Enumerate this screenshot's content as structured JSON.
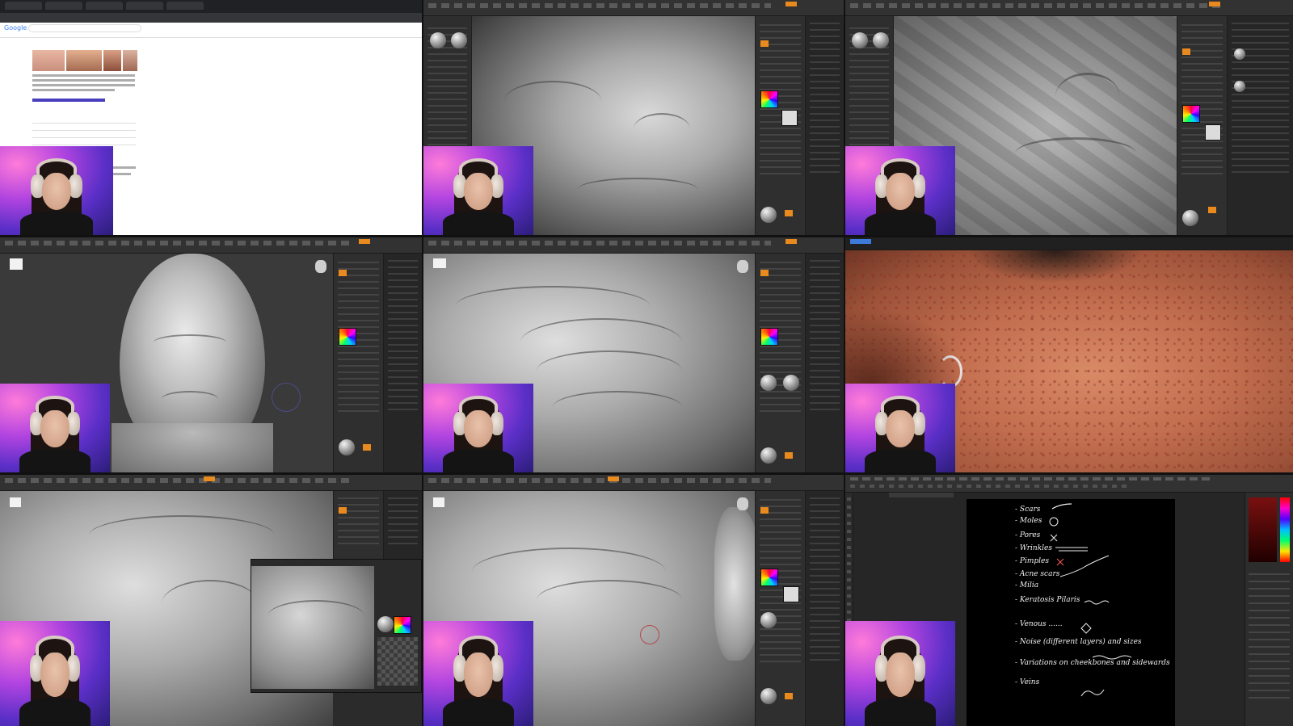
{
  "browser": {
    "logo_text": "Google"
  },
  "notes": {
    "lines": [
      "- Scars",
      "- Moles",
      "- Pores",
      "- Wrinkles",
      "- Pimples",
      "- Acne scars",
      "- Milia",
      "- Keratosis Pilaris",
      "- Venous ......",
      "- Noise (different layers) and sizes",
      "- Variations on cheekbones and sidewards",
      "- Veins"
    ]
  },
  "colors": {
    "zbrush_accent": "#e98a1e",
    "zbrush_bg": "#2b2b2b",
    "ps_canvas": "#000000"
  }
}
